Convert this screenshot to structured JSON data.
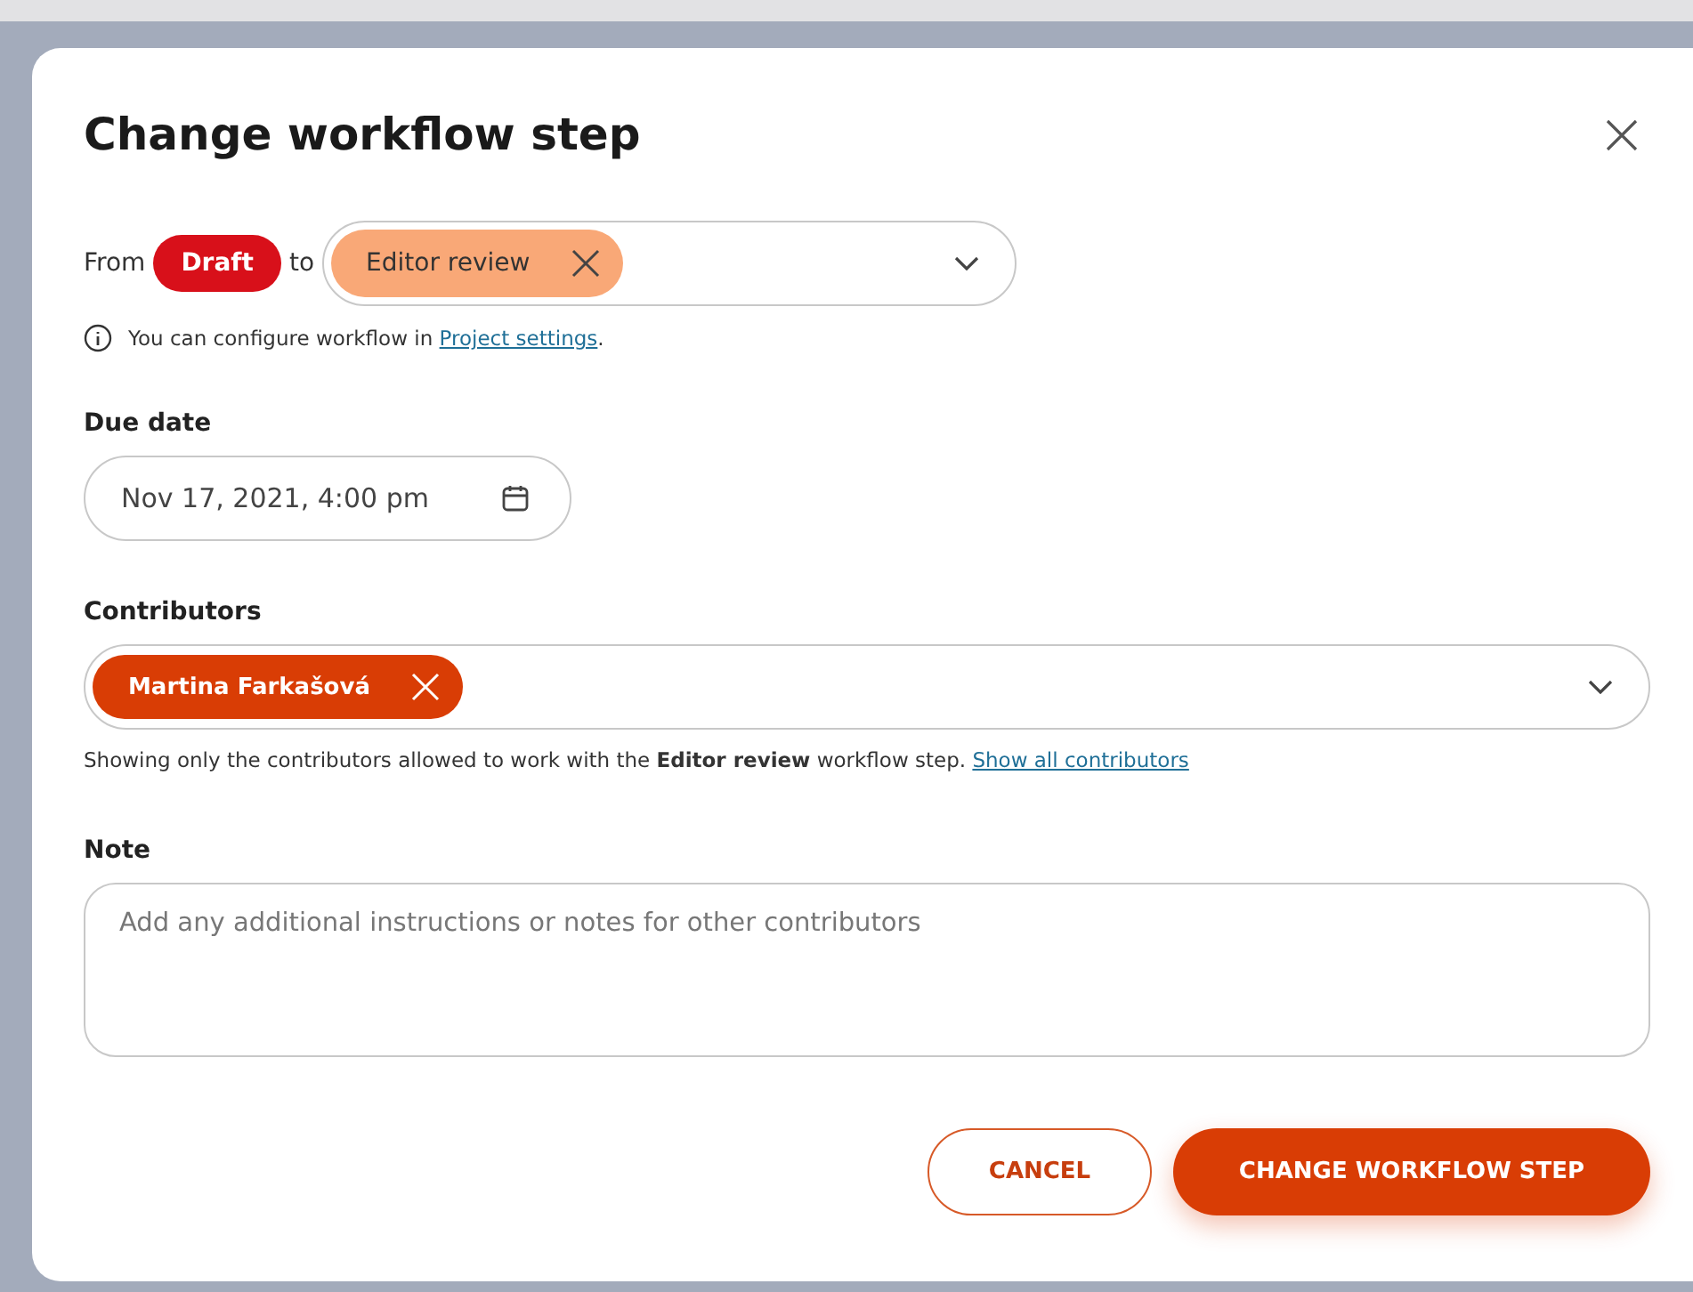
{
  "dialog": {
    "title": "Change workflow step"
  },
  "step": {
    "from_label": "From",
    "from": "Draft",
    "to_label": "to",
    "to": "Editor review"
  },
  "info": {
    "text": "You can configure workflow in ",
    "link": "Project settings",
    "suffix": "."
  },
  "due_date": {
    "label": "Due date",
    "value": "Nov 17, 2021, 4:00 pm"
  },
  "contributors": {
    "label": "Contributors",
    "chips": [
      "Martina Farkašová"
    ],
    "hint": "Showing only the contributors allowed to work with the **Editor review** workflow step. ",
    "link": "Show all contributors"
  },
  "note": {
    "label": "Note",
    "placeholder": "Add any additional instructions or notes for other contributors"
  },
  "buttons": [
    {
      "label": "CANCEL",
      "kind": "secondary"
    },
    {
      "label": "CHANGE WORKFLOW STEP",
      "kind": "primary"
    }
  ]
}
